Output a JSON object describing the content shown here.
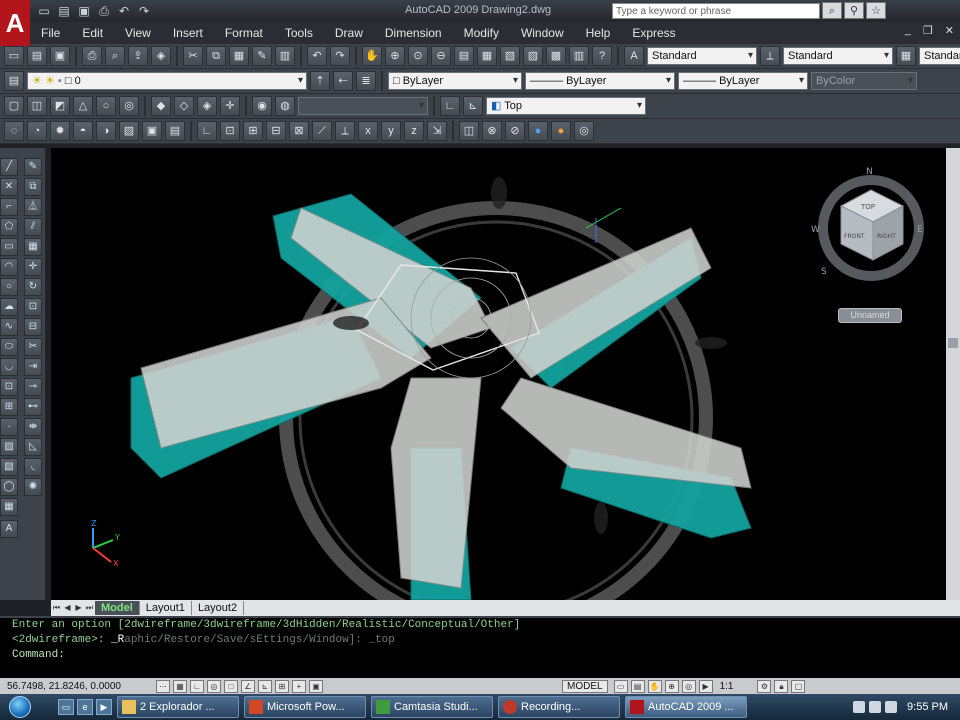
{
  "app": {
    "logo_letter": "A",
    "window_title": "AutoCAD 2009 Drawing2.dwg",
    "search_placeholder": "Type a keyword or phrase",
    "search_icons": [
      "binoculars-icon",
      "comm-center-icon",
      "favorites-icon",
      "help-icon"
    ]
  },
  "menubar": {
    "items": [
      "File",
      "Edit",
      "View",
      "Insert",
      "Format",
      "Tools",
      "Draw",
      "Dimension",
      "Modify",
      "Window",
      "Help",
      "Express"
    ]
  },
  "toolbar": {
    "text_style": "Standard",
    "dim_style": "Standard",
    "table_style": "Standard",
    "layer": "0",
    "color": "ByLayer",
    "linetype": "ByLayer",
    "lineweight": "ByLayer",
    "plot_style": "ByColor",
    "view": "Top"
  },
  "viewport": {
    "viewcube_faces": [
      "TOP",
      "FRONT",
      "RIGHT"
    ],
    "compass": [
      "N",
      "W",
      "E",
      "S"
    ],
    "ucs_label": "Unnamed",
    "ucs_axes": [
      "Z",
      "Y",
      "X"
    ]
  },
  "tabs": {
    "items": [
      "Model",
      "Layout1",
      "Layout2"
    ],
    "active": "Model"
  },
  "command_line": {
    "line1": "Enter an option [2dwireframe/3dwireframe/3dHidden/Realistic/Conceptual/Other]",
    "line2_prefix": "<2dwireframe>: ",
    "line2_typed": "_R",
    "line2_ghost": "aphic/Restore/Save/sEttings/Window]: _top",
    "line3": "Command:"
  },
  "statusbar": {
    "coords": "56.7498, 21.8246, 0.0000",
    "model_label": "MODEL",
    "scale": "1:1"
  },
  "taskbar": {
    "buttons": [
      {
        "label": "2 Explorador ...",
        "icon_color": "#e8c15a"
      },
      {
        "label": "Microsoft Pow...",
        "icon_color": "#d24726"
      },
      {
        "label": "Camtasia Studi...",
        "icon_color": "#3f9b3f"
      },
      {
        "label": "Recording...",
        "icon_color": "#c0392b"
      },
      {
        "label": "AutoCAD 2009 ...",
        "icon_color": "#b1141b"
      }
    ],
    "clock": "9:55 PM"
  }
}
